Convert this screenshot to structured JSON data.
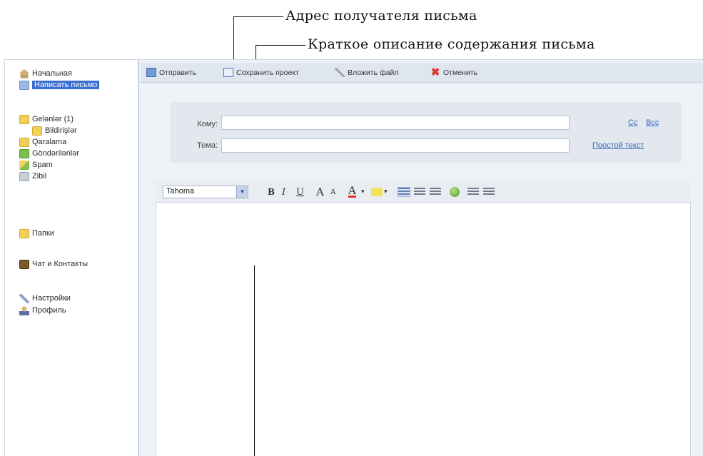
{
  "annotations": {
    "recipient": "Адрес получателя письма",
    "subject": "Краткое описание содержания письма"
  },
  "sidebar": {
    "items": [
      {
        "label": "Начальная",
        "icon": "home-icon"
      },
      {
        "label": "Написать письмо",
        "icon": "compose-icon",
        "active": true
      },
      {
        "label": "Gelənlər (1)",
        "icon": "folder-icon"
      },
      {
        "label": "Bildirişlər",
        "icon": "folder-icon"
      },
      {
        "label": "Qaralama",
        "icon": "folder-icon"
      },
      {
        "label": "Göndərilənlər",
        "icon": "sent-icon"
      },
      {
        "label": "Spam",
        "icon": "spam-icon"
      },
      {
        "label": "Zibil",
        "icon": "trash-icon"
      },
      {
        "label": "Папки",
        "icon": "folder-icon"
      },
      {
        "label": "Чат и Контакты",
        "icon": "contacts-icon"
      },
      {
        "label": "Настройки",
        "icon": "settings-icon"
      },
      {
        "label": "Профиль",
        "icon": "profile-icon"
      }
    ]
  },
  "toolbar": {
    "send": "Отправить",
    "save_draft": "Сохранить проект",
    "attach": "Вложить файл",
    "cancel": "Отменить"
  },
  "compose": {
    "to_label": "Кому:",
    "to_value": "",
    "subject_label": "Тема:",
    "subject_value": "",
    "cc": "Cc",
    "bcc": "Bcc",
    "plain_text": "Простой текст"
  },
  "format": {
    "font": "Tahoma",
    "bold": "B",
    "italic": "I",
    "underline": "U",
    "grow": "A",
    "shrink": "A",
    "color": "A"
  }
}
